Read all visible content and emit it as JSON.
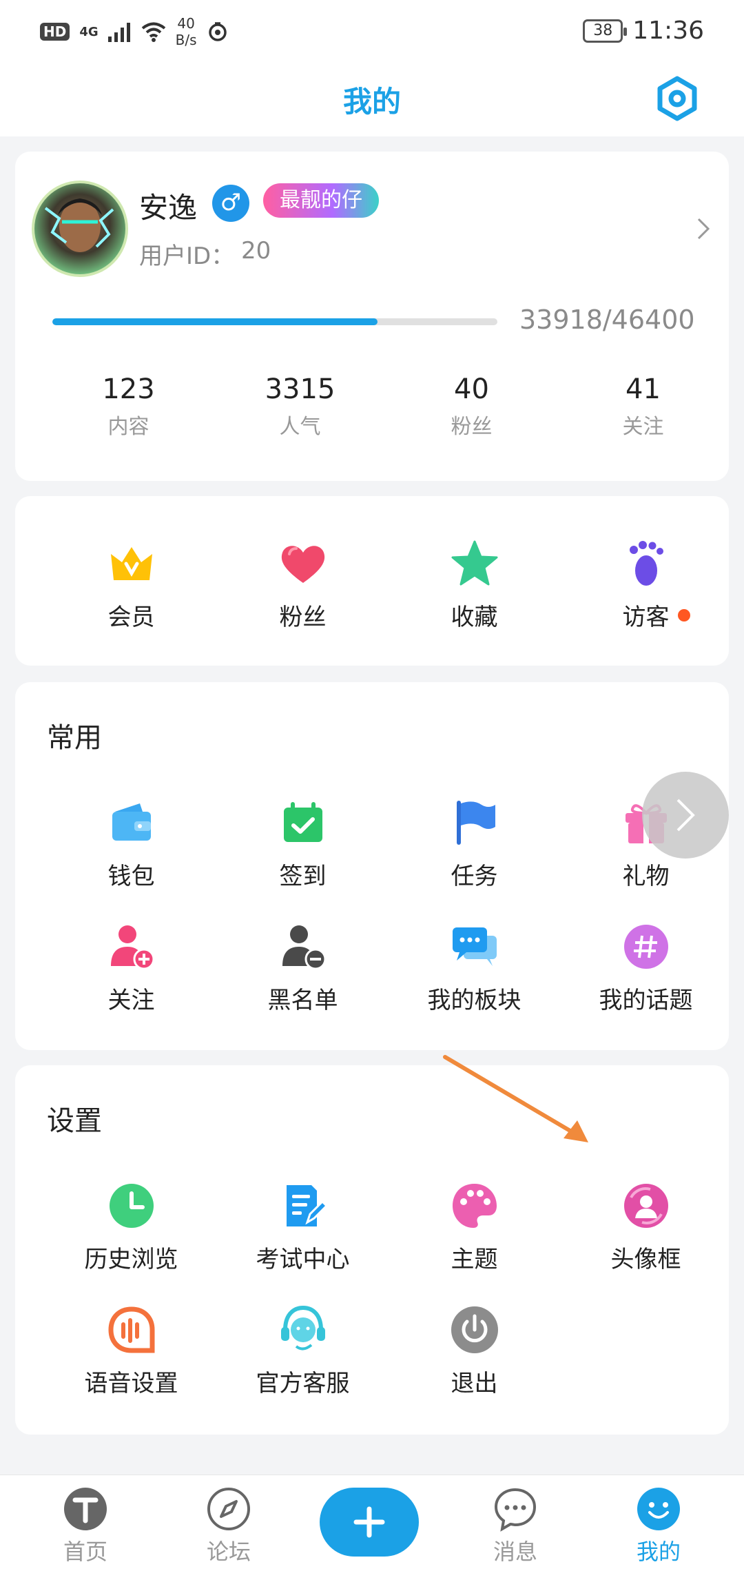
{
  "status_bar": {
    "hd": "HD",
    "network": "4G",
    "speed_value": "40",
    "speed_unit": "B/s",
    "battery": "38",
    "time": "11:36"
  },
  "header": {
    "title": "我的",
    "settings_icon": "settings-hexagon-icon"
  },
  "profile": {
    "name": "安逸",
    "gender_symbol": "♂",
    "title_badge": "最靓的仔",
    "user_id_label": "用户ID：",
    "user_id_value": "20",
    "xp_text": "33918/46400",
    "xp_progress_fraction": 0.73,
    "stats": [
      {
        "value": "123",
        "label": "内容"
      },
      {
        "value": "3315",
        "label": "人气"
      },
      {
        "value": "40",
        "label": "粉丝"
      },
      {
        "value": "41",
        "label": "关注"
      }
    ]
  },
  "quick": [
    {
      "label": "会员",
      "icon": "crown-icon"
    },
    {
      "label": "粉丝",
      "icon": "heart-icon"
    },
    {
      "label": "收藏",
      "icon": "star-icon"
    },
    {
      "label": "访客",
      "icon": "footprint-icon",
      "has_dot": true
    }
  ],
  "common": {
    "title": "常用",
    "items": [
      {
        "label": "钱包",
        "icon": "wallet-icon"
      },
      {
        "label": "签到",
        "icon": "calendar-check-icon"
      },
      {
        "label": "任务",
        "icon": "flag-icon"
      },
      {
        "label": "礼物",
        "icon": "gift-icon"
      },
      {
        "label": "关注",
        "icon": "user-add-icon"
      },
      {
        "label": "黑名单",
        "icon": "user-block-icon"
      },
      {
        "label": "我的板块",
        "icon": "chat-bubbles-icon"
      },
      {
        "label": "我的话题",
        "icon": "hashtag-icon"
      }
    ]
  },
  "settings": {
    "title": "设置",
    "items": [
      {
        "label": "历史浏览",
        "icon": "clock-icon"
      },
      {
        "label": "考试中心",
        "icon": "exam-edit-icon"
      },
      {
        "label": "主题",
        "icon": "palette-icon"
      },
      {
        "label": "头像框",
        "icon": "avatar-frame-icon"
      },
      {
        "label": "语音设置",
        "icon": "voice-icon"
      },
      {
        "label": "官方客服",
        "icon": "customer-service-icon"
      },
      {
        "label": "退出",
        "icon": "power-icon"
      }
    ]
  },
  "tabbar": [
    {
      "label": "首页",
      "icon": "home-t-icon"
    },
    {
      "label": "论坛",
      "icon": "compass-icon"
    },
    {
      "label": "消息",
      "icon": "message-icon"
    },
    {
      "label": "我的",
      "icon": "smile-icon",
      "active": true
    }
  ],
  "colors": {
    "accent": "#1ba1e6",
    "background": "#f3f4f6",
    "annotation_arrow": "#f08a3c"
  }
}
